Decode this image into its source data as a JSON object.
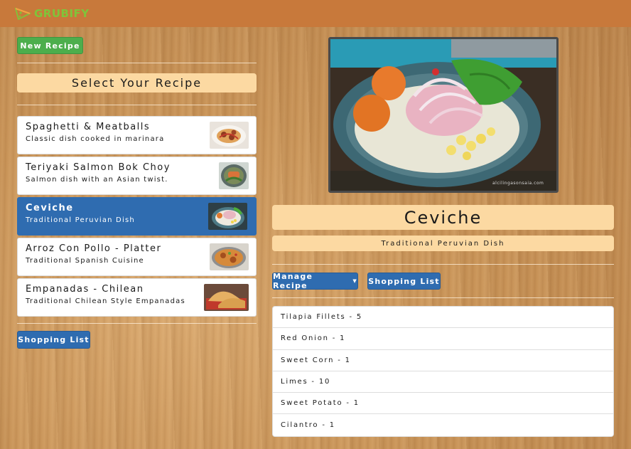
{
  "app": {
    "name": "GRUBIFY",
    "brand_icon": "pizza-slice-icon"
  },
  "colors": {
    "navbar": "#c8793b",
    "brand": "#7fc43a",
    "primary": "#2f6cb0",
    "success": "#4cae4c",
    "header_box": "#fcd9a2"
  },
  "sidebar": {
    "new_recipe_label": "New Recipe",
    "title": "Select Your Recipe",
    "recipes": [
      {
        "title": "Spaghetti & Meatballs",
        "desc": "Classic dish cooked in marinara",
        "active": false
      },
      {
        "title": "Teriyaki Salmon Bok Choy",
        "desc": "Salmon dish with an Asian twist.",
        "active": false
      },
      {
        "title": "Ceviche",
        "desc": "Traditional Peruvian Dish",
        "active": true
      },
      {
        "title": "Arroz Con Pollo - Platter",
        "desc": "Traditional Spanish Cuisine",
        "active": false
      },
      {
        "title": "Empanadas - Chilean",
        "desc": "Traditional Chilean Style Empanadas",
        "active": false
      }
    ],
    "shopping_list_label": "Shopping List"
  },
  "detail": {
    "photo_credit": "alcilingasonsaia.com",
    "title": "Ceviche",
    "subtitle": "Traditional Peruvian Dish",
    "manage_label": "Manage Recipe",
    "shopping_list_label": "Shopping List",
    "ingredients": [
      "Tilapia Fillets - 5",
      "Red Onion - 1",
      "Sweet Corn - 1",
      "Limes - 10",
      "Sweet Potato - 1",
      "Cilantro - 1"
    ]
  }
}
